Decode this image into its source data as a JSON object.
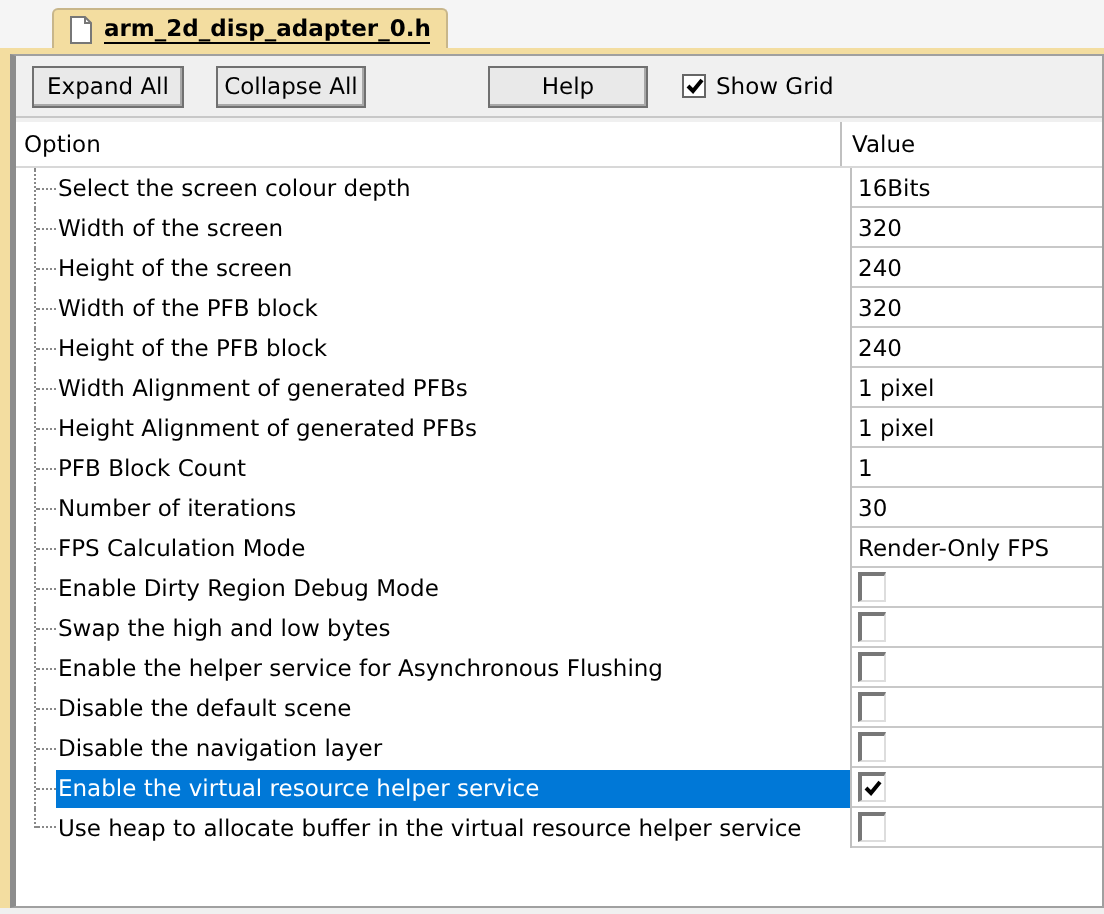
{
  "tab": {
    "title": "arm_2d_disp_adapter_0.h",
    "selected": true
  },
  "toolbar": {
    "buttons": [
      "Expand All",
      "Collapse All",
      "Help"
    ],
    "show_grid": {
      "label": "Show Grid",
      "checked": true
    }
  },
  "table": {
    "columns": [
      "Option",
      "Value"
    ],
    "rows": [
      {
        "option": "Select the screen colour depth",
        "kind": "text",
        "value": "16Bits",
        "selected": false
      },
      {
        "option": "Width of the screen",
        "kind": "text",
        "value": "320",
        "selected": false
      },
      {
        "option": "Height of the screen",
        "kind": "text",
        "value": "240",
        "selected": false
      },
      {
        "option": "Width of the PFB block",
        "kind": "text",
        "value": "320",
        "selected": false
      },
      {
        "option": "Height of the PFB block",
        "kind": "text",
        "value": "240",
        "selected": false
      },
      {
        "option": "Width Alignment of generated PFBs",
        "kind": "text",
        "value": "1 pixel",
        "selected": false
      },
      {
        "option": "Height Alignment of generated PFBs",
        "kind": "text",
        "value": "1 pixel",
        "selected": false
      },
      {
        "option": "PFB Block Count",
        "kind": "text",
        "value": "1",
        "selected": false
      },
      {
        "option": "Number of iterations",
        "kind": "text",
        "value": "30",
        "selected": false
      },
      {
        "option": "FPS Calculation Mode",
        "kind": "text",
        "value": "Render-Only FPS",
        "selected": false
      },
      {
        "option": "Enable Dirty Region Debug Mode",
        "kind": "checkbox",
        "checked": false,
        "selected": false
      },
      {
        "option": "Swap the high and low bytes",
        "kind": "checkbox",
        "checked": false,
        "selected": false
      },
      {
        "option": "Enable the helper service for Asynchronous Flushing",
        "kind": "checkbox",
        "checked": false,
        "selected": false
      },
      {
        "option": "Disable the default scene",
        "kind": "checkbox",
        "checked": false,
        "selected": false
      },
      {
        "option": "Disable the navigation layer",
        "kind": "checkbox",
        "checked": false,
        "selected": false
      },
      {
        "option": "Enable the virtual resource helper service",
        "kind": "checkbox",
        "checked": true,
        "selected": true
      },
      {
        "option": "Use heap to allocate buffer in the virtual resource helper service",
        "kind": "checkbox",
        "checked": false,
        "selected": false
      }
    ]
  }
}
